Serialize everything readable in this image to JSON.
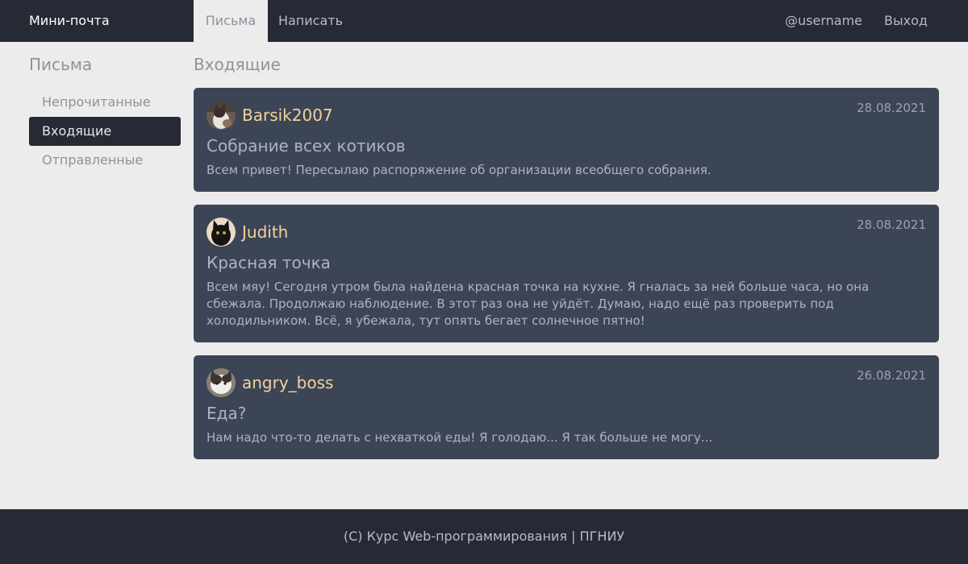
{
  "nav": {
    "brand": "Мини-почта",
    "letters": "Письма",
    "compose": "Написать",
    "user": "@username",
    "logout": "Выход"
  },
  "sidebar": {
    "title": "Письма",
    "items": [
      {
        "label": "Непрочитанные"
      },
      {
        "label": "Входящие",
        "active": true
      },
      {
        "label": "Отправленные"
      }
    ]
  },
  "main": {
    "title": "Входящие",
    "messages": [
      {
        "sender": "Barsik2007",
        "date": "28.08.2021",
        "subject": "Собрание всех котиков",
        "preview": "Всем привет! Пересылаю распоряжение об организации всеобщего собрания."
      },
      {
        "sender": "Judith",
        "date": "28.08.2021",
        "subject": "Красная точка",
        "preview": "Всем мяу! Сегодня утром была найдена красная точка на кухне. Я гналась за ней больше часа, но она сбежала. Продолжаю наблюдение. В этот раз она не уйдёт. Думаю, надо ещё раз проверить под холодильником. Всё, я убежала, тут опять бегает солнечное пятно!"
      },
      {
        "sender": "angry_boss",
        "date": "26.08.2021",
        "subject": "Еда?",
        "preview": "Нам надо что-то делать с нехваткой еды! Я голодаю... Я так больше не могу..."
      }
    ]
  },
  "footer": {
    "text": "(C) Курс Web-программирования | ПГНИУ"
  },
  "colors": {
    "navbar": "#252a35",
    "background": "#ececec",
    "card": "#3c4555",
    "sender": "#f2d29c"
  }
}
